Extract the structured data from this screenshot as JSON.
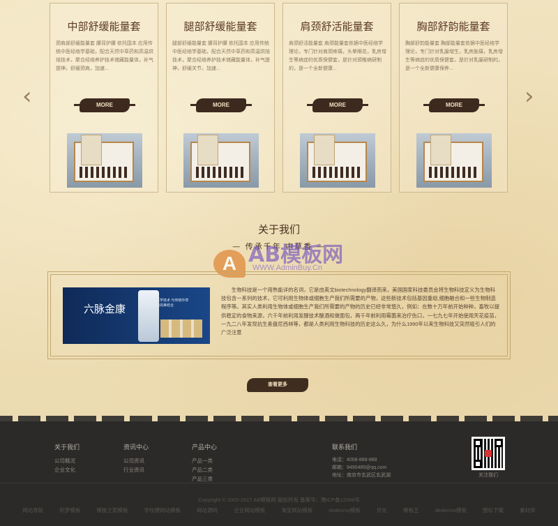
{
  "products": [
    {
      "title": "中部舒缓能量套",
      "desc": "颈肩部舒缓能量套 腰背护腰 依托国本 应用传统中医经络学基础，配合天然中草药和高温烘焙技术，聚合经络养护技术储藏能量体，补气提神，舒缓颈肩，加速...",
      "more": "MORE"
    },
    {
      "title": "腿部舒缓能量套",
      "desc": "腿部舒缓能量套 腰背护腰 依托国本 应用传统中医经络学基础，配合天然中草药和高温烘焙技术，聚合经络养护技术储藏能量体，补气提神，舒缓关节，加速...",
      "more": "MORE"
    },
    {
      "title": "肩颈舒活能量套",
      "desc": "肩颈舒活能量套 肩颈能量套依据中医经络学理论，专门针对肩颈疼痛，头晕眼花，乳房增生等病症的优质保健套，是针对颈椎病研制的，是一个全新健康...",
      "more": "MORE"
    },
    {
      "title": "胸部舒韵能量套",
      "desc": "胸部舒韵能量套 胸部能量套依据中医经络学理论，专门针对乳腺增生，乳房胀痛，乳房增生等病症的优质保健套，是针对乳腺研制的，是一个全新健康保养...",
      "more": "MORE"
    }
  ],
  "about": {
    "title": "关于我们",
    "subtitle": "— 传承千年  中草香 —",
    "image_brand": "六脉金康",
    "image_slogan": "现代医学技术 与传统中草本方的完美结合",
    "text": "生物科技是一个用熟能详的名词，它是由英文biotechnology翻译而来，美国国家科技委员会将生物科技定义为生物科技包含一系列的技术，它可利用生物体或细胞生产我们所需要的产物，这些新技术包括基因重组,细胞融合和一些生物制造程序等。其实人类利用生物体或细胞生产我们所需要的产物的历史已经非常悠久，例如：在数十万年前开始种种，畜牧以提供稳定的食物来源，六千年前利用发酵技术酿酒和做面包，两千年前利用霉菌来治疗伤口，一七九七年开始使用天花疫苗，一九二八年发现抗生素盘尼西林等，都是人类利用生物科技的历史这么久，为什么1990年以来生物科技又突然吸引人们的广泛注意",
    "see_more": "查看更多"
  },
  "watermark": {
    "badge": "A",
    "text": "AB模板网",
    "url": "WWW.AdminBuy.Cn"
  },
  "nav_arrows": {
    "left": "‹",
    "right": "›"
  },
  "footer": {
    "columns": [
      {
        "head": "关于我们",
        "links": [
          "公司概况",
          "企业文化"
        ]
      },
      {
        "head": "资讯中心",
        "links": [
          "公司资讯",
          "行业资讯"
        ]
      },
      {
        "head": "产品中心",
        "links": [
          "产品一类",
          "产品二类",
          "产品三类"
        ]
      }
    ],
    "contact": {
      "head": "联系我们",
      "rows": [
        "电话：4008-888-888",
        "邮箱：9490489@qq.com",
        "地址：南京市玄武区玄武湖"
      ]
    },
    "qr_caption": "关注我们",
    "copyright": "Copyright © 2002-2017 AB模板网 版权所有  备案号：豫ICP备12066号",
    "links": [
      "网站导航",
      "织梦模板",
      "模板之家模板",
      "学校建网站模板",
      "网站源码",
      "企业网站模板",
      "淘宝网站模板",
      "dedecms模板",
      "优化",
      "模板王",
      "dedecms模板",
      "图标下载",
      "素材库"
    ]
  }
}
